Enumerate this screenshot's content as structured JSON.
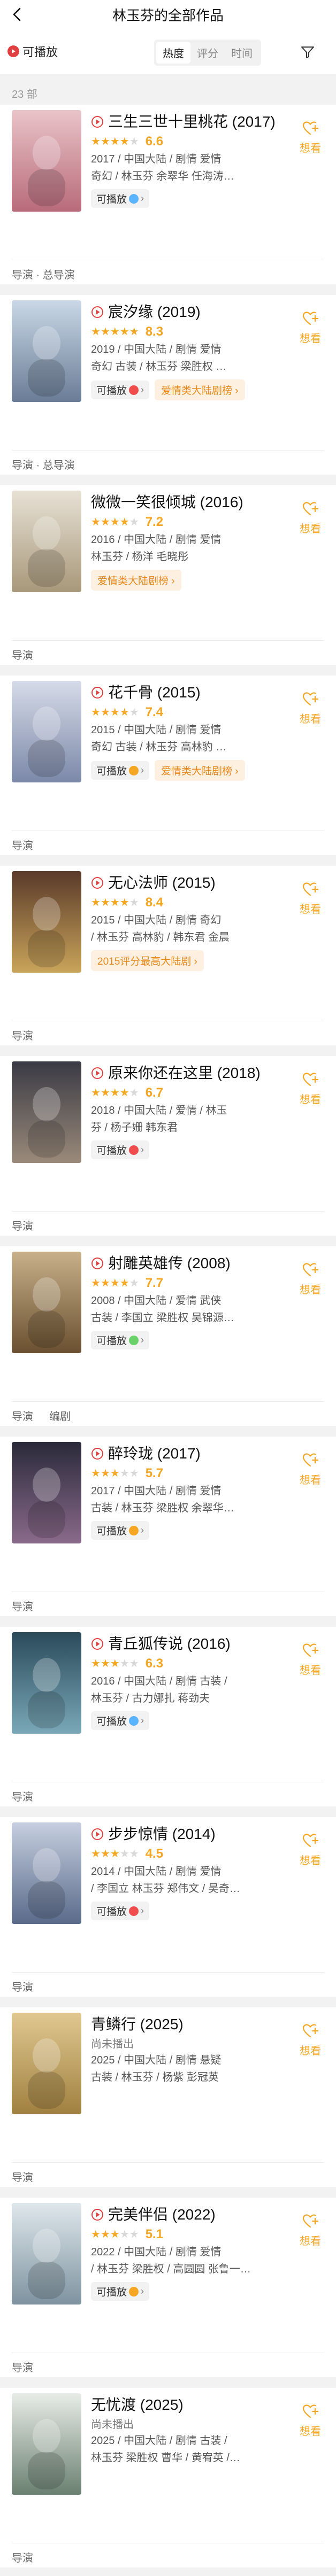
{
  "header": {
    "title": "林玉芬的全部作品"
  },
  "filter": {
    "playable_label": "可播放",
    "tabs": [
      "热度",
      "评分",
      "时间"
    ],
    "active_tab": "热度"
  },
  "count_text": "23 部",
  "want_label": "想看",
  "colors": {
    "accent": "#f5a623",
    "play_red": "#e04040",
    "rank_bg": "#fdf0e0",
    "rank_text": "#e58a1b"
  },
  "works": [
    {
      "title": "三生三世十里桃花 (2017)",
      "has_play_icon": true,
      "stars": 3.5,
      "score": "6.6",
      "meta1": "2017 / 中国大陆 / 剧情 爱情",
      "meta2": "奇幻 / 林玉芬 余翠华 任海涛…",
      "playable": "可播放",
      "rank_tag": "",
      "roles": [
        "导演 · 总导演"
      ]
    },
    {
      "title": "宸汐缘 (2019)",
      "has_play_icon": true,
      "stars": 4.5,
      "score": "8.3",
      "meta1": "2019 / 中国大陆 / 剧情 爱情",
      "meta2": "奇幻 古装 / 林玉芬 梁胜权 …",
      "playable": "可播放",
      "rank_tag": "爱情类大陆剧榜",
      "roles": [
        "导演 · 总导演"
      ]
    },
    {
      "title": "微微一笑很倾城 (2016)",
      "has_play_icon": false,
      "stars": 3.5,
      "score": "7.2",
      "meta1": "2016 / 中国大陆 / 剧情 爱情",
      "meta2": "林玉芬 / 杨洋 毛晓彤",
      "playable": "",
      "rank_tag": "爱情类大陆剧榜",
      "roles": [
        "导演"
      ]
    },
    {
      "title": "花千骨 (2015)",
      "has_play_icon": true,
      "stars": 4,
      "score": "7.4",
      "meta1": "2015 / 中国大陆 / 剧情 爱情",
      "meta2": "奇幻 古装 / 林玉芬 高林豹 …",
      "playable": "可播放",
      "rank_tag": "爱情类大陆剧榜",
      "roles": [
        "导演"
      ]
    },
    {
      "title": "无心法师 (2015)",
      "has_play_icon": true,
      "stars": 4,
      "score": "8.4",
      "meta1": "2015 / 中国大陆 / 剧情 奇幻",
      "meta2": "/ 林玉芬 高林豹 / 韩东君 金晨",
      "playable": "",
      "rank_tag": "2015评分最高大陆剧",
      "roles": [
        "导演"
      ]
    },
    {
      "title": "原来你还在这里 (2018)",
      "has_play_icon": true,
      "stars": 3.5,
      "score": "6.7",
      "meta1": "2018 / 中国大陆 / 爱情 / 林玉",
      "meta2": "芬 / 杨子姗 韩东君",
      "playable": "可播放",
      "rank_tag": "",
      "roles": [
        "导演"
      ]
    },
    {
      "title": "射雕英雄传 (2008)",
      "has_play_icon": true,
      "stars": 4,
      "score": "7.7",
      "meta1": "2008 / 中国大陆 / 爱情 武侠",
      "meta2": "古装 / 李国立 梁胜权 吴锦源…",
      "playable": "可播放",
      "rank_tag": "",
      "roles": [
        "导演",
        "编剧"
      ]
    },
    {
      "title": "醉玲珑 (2017)",
      "has_play_icon": true,
      "stars": 3,
      "score": "5.7",
      "meta1": "2017 / 中国大陆 / 剧情 爱情",
      "meta2": "古装 / 林玉芬 梁胜权 余翠华…",
      "playable": "可播放",
      "rank_tag": "",
      "roles": [
        "导演"
      ]
    },
    {
      "title": "青丘狐传说 (2016)",
      "has_play_icon": true,
      "stars": 3,
      "score": "6.3",
      "meta1": "2016 / 中国大陆 / 剧情 古装 /",
      "meta2": "林玉芬 / 古力娜扎 蒋劲夫",
      "playable": "可播放",
      "rank_tag": "",
      "roles": [
        "导演"
      ]
    },
    {
      "title": "步步惊情 (2014)",
      "has_play_icon": true,
      "stars": 2.5,
      "score": "4.5",
      "meta1": "2014 / 中国大陆 / 剧情 爱情",
      "meta2": "/ 李国立 林玉芬 郑伟文 / 吴奇…",
      "playable": "可播放",
      "rank_tag": "",
      "roles": [
        "导演"
      ]
    },
    {
      "title": "青鳞行 (2025)",
      "has_play_icon": false,
      "unaired": "尚未播出",
      "stars": 0,
      "score": "",
      "meta1": "2025 / 中国大陆 / 剧情 悬疑",
      "meta2": "古装 / 林玉芬 / 杨紫 彭冠英",
      "playable": "",
      "rank_tag": "",
      "roles": [
        "导演"
      ]
    },
    {
      "title": "完美伴侣 (2022)",
      "has_play_icon": true,
      "stars": 2.5,
      "score": "5.1",
      "meta1": "2022 / 中国大陆 / 剧情 爱情",
      "meta2": "/ 林玉芬 梁胜权 / 高圆圆 张鲁一…",
      "playable": "可播放",
      "rank_tag": "",
      "roles": [
        "导演"
      ]
    },
    {
      "title": "无忧渡 (2025)",
      "has_play_icon": false,
      "unaired": "尚未播出",
      "stars": 0,
      "score": "",
      "meta1": "2025 / 中国大陆 / 剧情 古装 /",
      "meta2": "林玉芬 梁胜权 曹华 / 黄宥英 /…",
      "playable": "",
      "rank_tag": "",
      "roles": [
        "导演"
      ]
    }
  ]
}
